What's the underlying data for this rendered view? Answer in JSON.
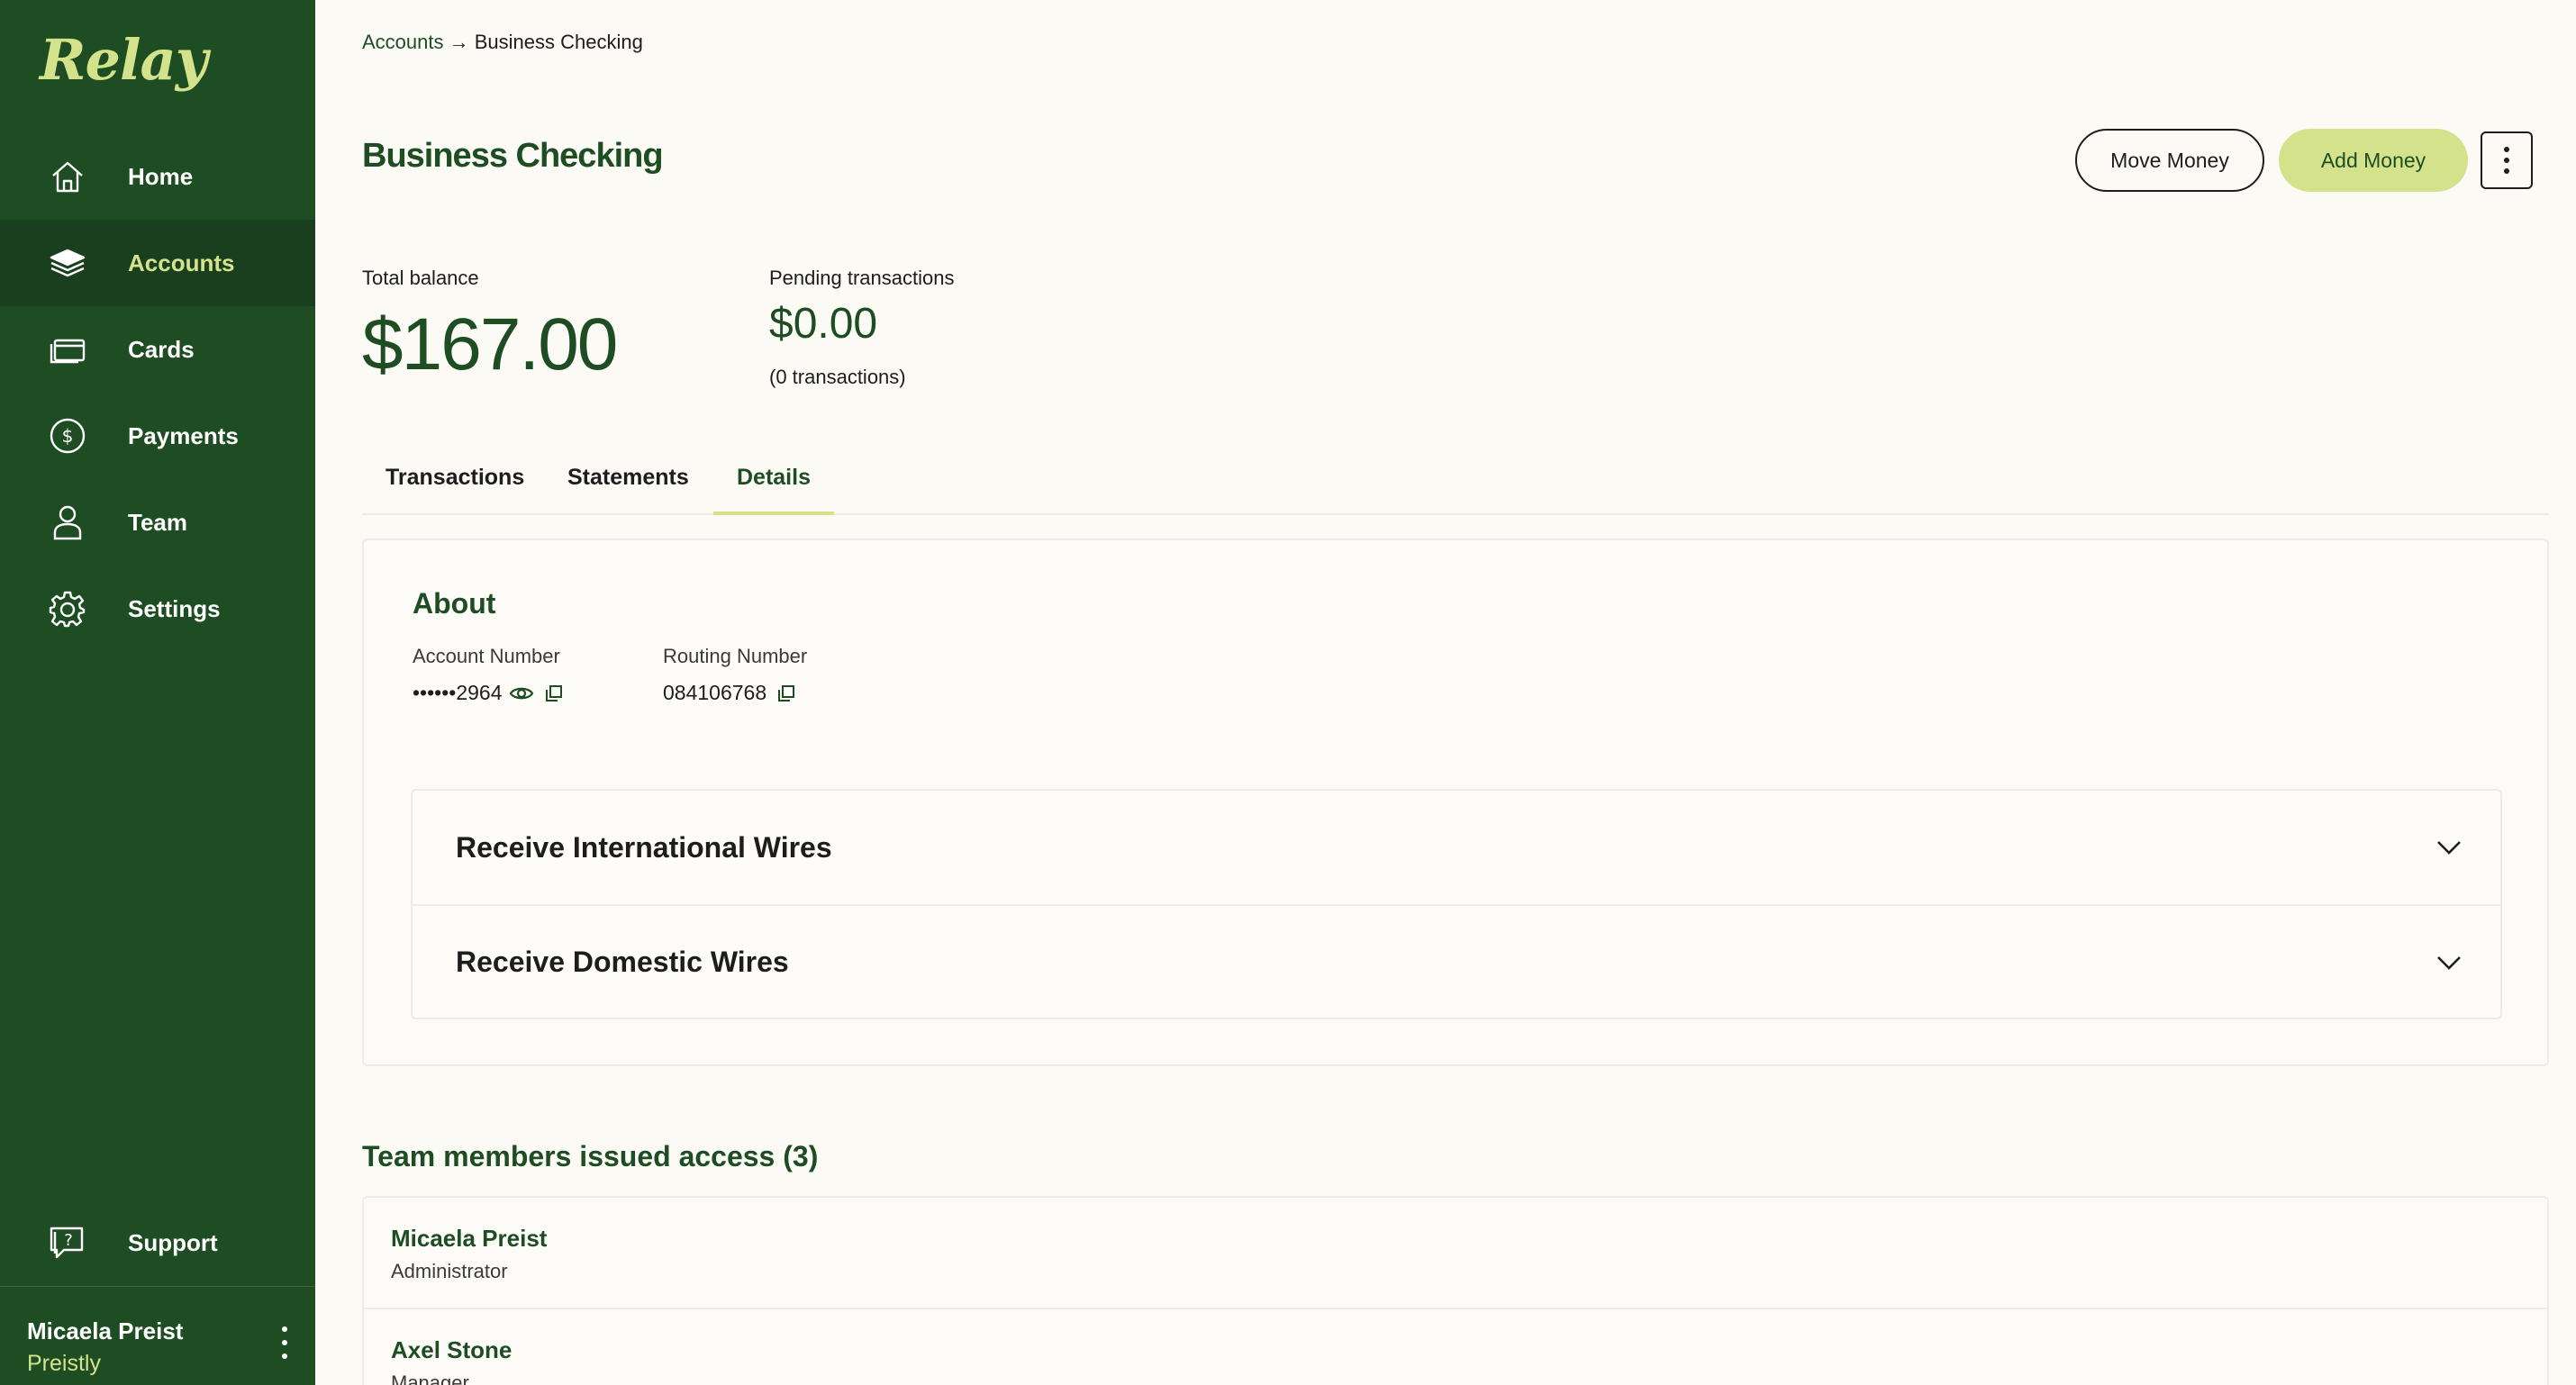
{
  "brand": {
    "logo_text": "Relay"
  },
  "sidebar": {
    "items": [
      {
        "label": "Home",
        "icon": "home-icon"
      },
      {
        "label": "Accounts",
        "icon": "layers-icon",
        "active": true
      },
      {
        "label": "Cards",
        "icon": "card-icon"
      },
      {
        "label": "Payments",
        "icon": "dollar-circle-icon"
      },
      {
        "label": "Team",
        "icon": "person-icon"
      },
      {
        "label": "Settings",
        "icon": "gear-icon"
      }
    ],
    "support_label": "Support",
    "user": {
      "name": "Micaela Preist",
      "company": "Preistly"
    }
  },
  "breadcrumb": {
    "parent": "Accounts",
    "separator": "→",
    "current": "Business Checking"
  },
  "header": {
    "title": "Business Checking",
    "move_money_label": "Move Money",
    "add_money_label": "Add Money"
  },
  "balances": {
    "total_label": "Total balance",
    "total_value": "$167.00",
    "pending_label": "Pending transactions",
    "pending_value": "$0.00",
    "pending_count": "(0 transactions)"
  },
  "tabs": [
    {
      "label": "Transactions"
    },
    {
      "label": "Statements"
    },
    {
      "label": "Details",
      "active": true
    }
  ],
  "about": {
    "title": "About",
    "account_number_label": "Account Number",
    "account_number_value": "••••••2964",
    "routing_number_label": "Routing Number",
    "routing_number_value": "084106768"
  },
  "wires": [
    {
      "title": "Receive International Wires"
    },
    {
      "title": "Receive Domestic Wires"
    }
  ],
  "team": {
    "title": "Team members issued access (3)",
    "members": [
      {
        "name": "Micaela Preist",
        "role": "Administrator"
      },
      {
        "name": "Axel Stone",
        "role": "Manager"
      }
    ]
  },
  "colors": {
    "sidebar_bg": "#1e4d23",
    "accent_lime": "#d4e38b",
    "brand_green": "#1e4d23",
    "page_bg": "#fbfaf5"
  }
}
